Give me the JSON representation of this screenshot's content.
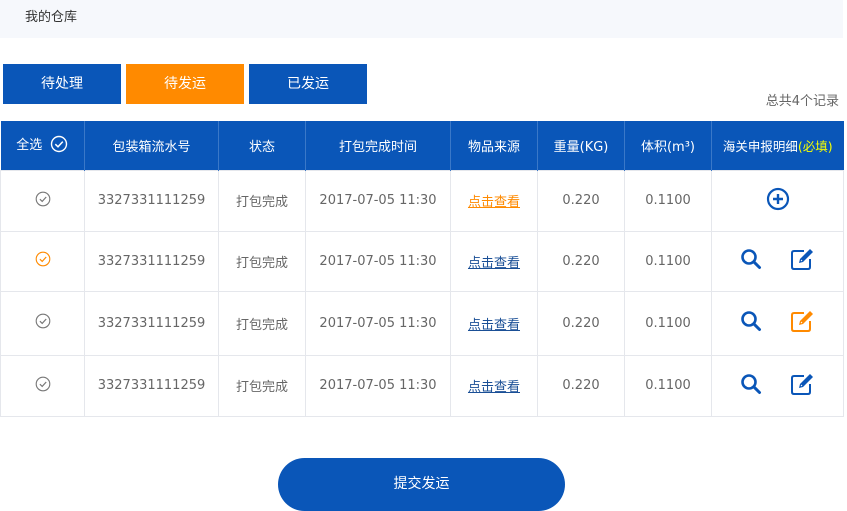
{
  "header": {
    "title": "我的仓库"
  },
  "tabs": [
    {
      "label": "待处理"
    },
    {
      "label": "待发运"
    },
    {
      "label": "已发运"
    }
  ],
  "summary": {
    "total": "总共4个记录"
  },
  "colors": {
    "primary": "#0a56b8",
    "accent": "#ff8a00",
    "required": "#f7ff00"
  },
  "table": {
    "headers": {
      "select_all": "全选",
      "box_no": "包装箱流水号",
      "status": "状态",
      "pack_time": "打包完成时间",
      "source": "物品来源",
      "weight": "重量(KG)",
      "volume": "体积(m³)",
      "customs": "海关申报明细",
      "customs_required": "(必填)"
    },
    "rows": [
      {
        "box_no": "3327331111259",
        "status": "打包完成",
        "pack_time": "2017-07-05 11:30",
        "source": "点击查看",
        "weight": "0.220",
        "volume": "0.1100"
      },
      {
        "box_no": "3327331111259",
        "status": "打包完成",
        "pack_time": "2017-07-05 11:30",
        "source": "点击查看",
        "weight": "0.220",
        "volume": "0.1100"
      },
      {
        "box_no": "3327331111259",
        "status": "打包完成",
        "pack_time": "2017-07-05 11:30",
        "source": "点击查看",
        "weight": "0.220",
        "volume": "0.1100"
      },
      {
        "box_no": "3327331111259",
        "status": "打包完成",
        "pack_time": "2017-07-05 11:30",
        "source": "点击查看",
        "weight": "0.220",
        "volume": "0.1100"
      }
    ]
  },
  "submit": {
    "label": "提交发运"
  }
}
